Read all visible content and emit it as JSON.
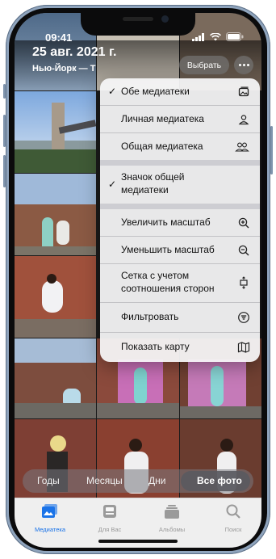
{
  "status_bar": {
    "time": "09:41"
  },
  "header": {
    "title": "25 авг. 2021 г.",
    "subtitle": "Нью-Йорк — Т",
    "select_label": "Выбрать"
  },
  "menu": {
    "items": [
      {
        "label": "Обе медиатеки",
        "checked": true,
        "icon": "photo-library-icon"
      },
      {
        "label": "Личная медиатека",
        "checked": false,
        "icon": "person-icon"
      },
      {
        "label": "Общая медиатека",
        "checked": false,
        "icon": "people-icon"
      },
      {
        "label_line1": "Значок общей",
        "label_line2": "медиатеки",
        "checked": true
      },
      {
        "label": "Увеличить масштаб",
        "icon": "zoom-in-icon"
      },
      {
        "label": "Уменьшить масштаб",
        "icon": "zoom-out-icon"
      },
      {
        "label_line1": "Сетка с учетом",
        "label_line2": "соотношения сторон",
        "icon": "aspect-ratio-icon"
      },
      {
        "label": "Фильтровать",
        "icon": "filter-icon"
      },
      {
        "label": "Показать карту",
        "icon": "map-icon"
      }
    ],
    "check_glyph": "✓"
  },
  "segments": {
    "items": [
      "Годы",
      "Месяцы",
      "Дни",
      "Все фото"
    ],
    "selected": "Все фото"
  },
  "tabbar": {
    "items": [
      {
        "label": "Медиатека",
        "active": true,
        "icon": "photos-library-icon"
      },
      {
        "label": "Для Вас",
        "active": false,
        "icon": "for-you-icon"
      },
      {
        "label": "Альбомы",
        "active": false,
        "icon": "albums-icon"
      },
      {
        "label": "Поиск",
        "active": false,
        "icon": "search-icon"
      }
    ]
  },
  "colors": {
    "accent": "#1a73e8",
    "menu_bg": "#f5f5f7",
    "tab_inactive": "#9a9a9a"
  }
}
